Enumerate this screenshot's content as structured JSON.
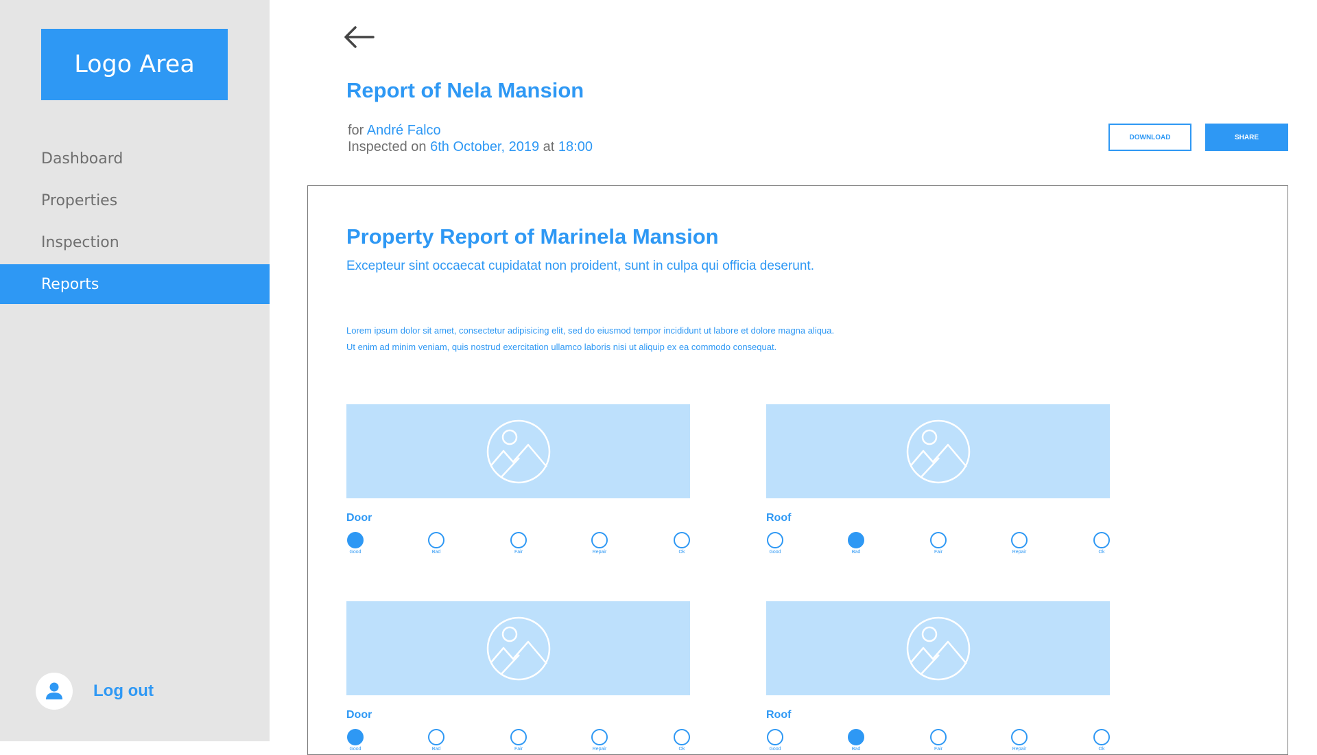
{
  "sidebar": {
    "logo": "Logo Area",
    "items": [
      {
        "label": "Dashboard",
        "active": false
      },
      {
        "label": "Properties",
        "active": false
      },
      {
        "label": "Inspection",
        "active": false
      },
      {
        "label": "Reports",
        "active": true
      }
    ],
    "logout_label": "Log out"
  },
  "header": {
    "title": "Report of Nela Mansion",
    "for_prefix": "for",
    "for_name": "André Falco",
    "inspected_prefix": "Inspected on",
    "inspected_date": "6th October, 2019",
    "at_word": "at",
    "inspected_time": "18:00",
    "download_label": "DOWNLOAD",
    "share_label": "SHARE"
  },
  "report": {
    "title": "Property Report of Marinela Mansion",
    "subtitle": "Excepteur sint occaecat cupidatat non proident, sunt in culpa qui officia deserunt.",
    "body": "Lorem ipsum dolor sit amet, consectetur adipisicing elit, sed do eiusmod tempor incididunt ut labore et dolore magna aliqua. Ut enim ad minim veniam, quis nostrud exercitation ullamco laboris nisi ut aliquip ex ea commodo consequat.",
    "rating_options": [
      "Good",
      "Bad",
      "Fair",
      "Repair",
      "Ok"
    ],
    "items": [
      {
        "label": "Door",
        "selected": "Good"
      },
      {
        "label": "Roof",
        "selected": "Bad"
      },
      {
        "label": "Door",
        "selected": "Good"
      },
      {
        "label": "Roof",
        "selected": "Bad"
      }
    ]
  },
  "colors": {
    "accent": "#2e98f4",
    "image_placeholder": "#bde0fc",
    "sidebar_bg": "#e5e5e5"
  }
}
